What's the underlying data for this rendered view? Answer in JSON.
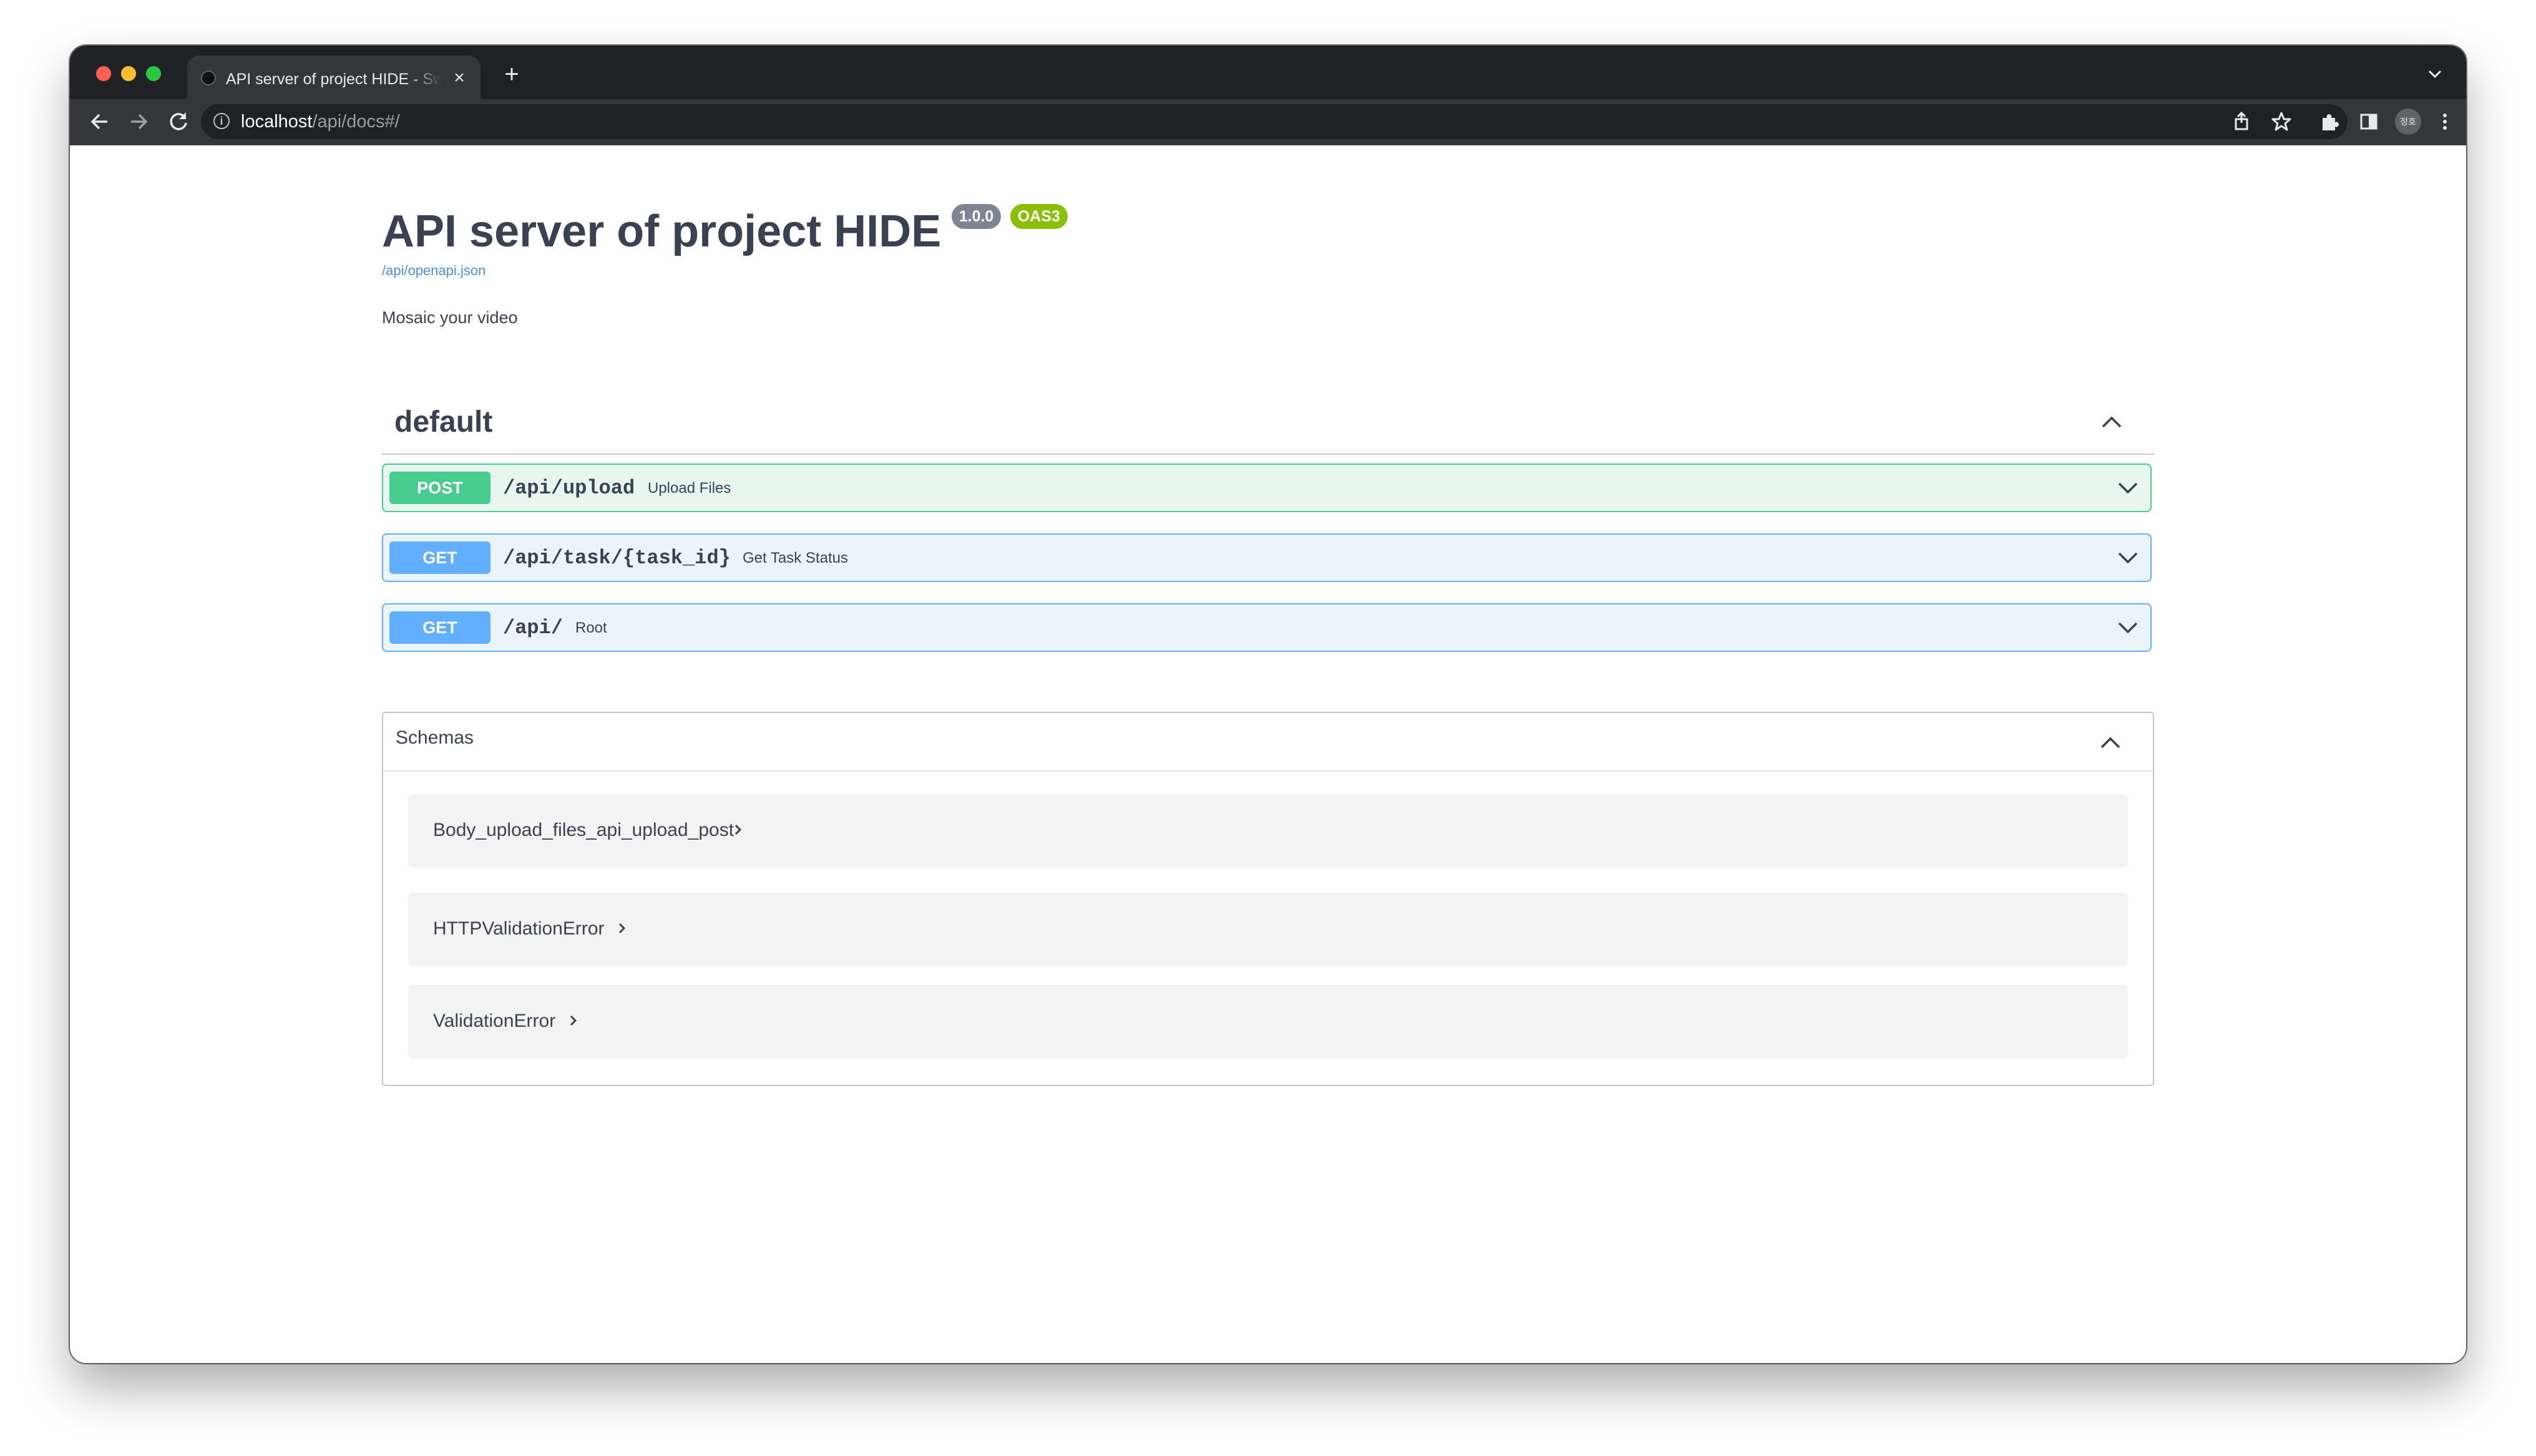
{
  "browser": {
    "tab_title": "API server of project HIDE - Swagger UI",
    "tab_close": "×",
    "new_tab": "+",
    "tab_menu": "⌄",
    "url_host": "localhost",
    "url_path": "/api/docs#/",
    "info_symbol": "i",
    "profile_initials": "정호",
    "icons": {
      "back": "back-arrow-icon",
      "forward": "forward-arrow-icon",
      "reload": "reload-icon",
      "share": "share-icon",
      "bookmark": "star-icon",
      "extensions": "puzzle-icon",
      "side_panel": "side-panel-icon",
      "menu": "kebab-menu-icon"
    }
  },
  "api": {
    "title": "API server of project HIDE",
    "version_badge": "1.0.0",
    "oas_badge": "OAS3",
    "spec_link": "/api/openapi.json",
    "description": "Mosaic your video"
  },
  "tag": {
    "name": "default",
    "expanded": true
  },
  "operations": [
    {
      "method": "POST",
      "path": "/api/upload",
      "summary": "Upload Files",
      "color": "#49cc90"
    },
    {
      "method": "GET",
      "path": "/api/task/{task_id}",
      "summary": "Get Task Status",
      "color": "#61affe"
    },
    {
      "method": "GET",
      "path": "/api/",
      "summary": "Root",
      "color": "#61affe"
    }
  ],
  "schemas": {
    "title": "Schemas",
    "expanded": true,
    "models": [
      "Body_upload_files_api_upload_post",
      "HTTPValidationError",
      "ValidationError"
    ]
  },
  "colors": {
    "text": "#3b4151",
    "post": "#49cc90",
    "get": "#61affe",
    "version_badge": "#7d8492",
    "oas_badge": "#89bf04",
    "link": "#4990e2"
  }
}
